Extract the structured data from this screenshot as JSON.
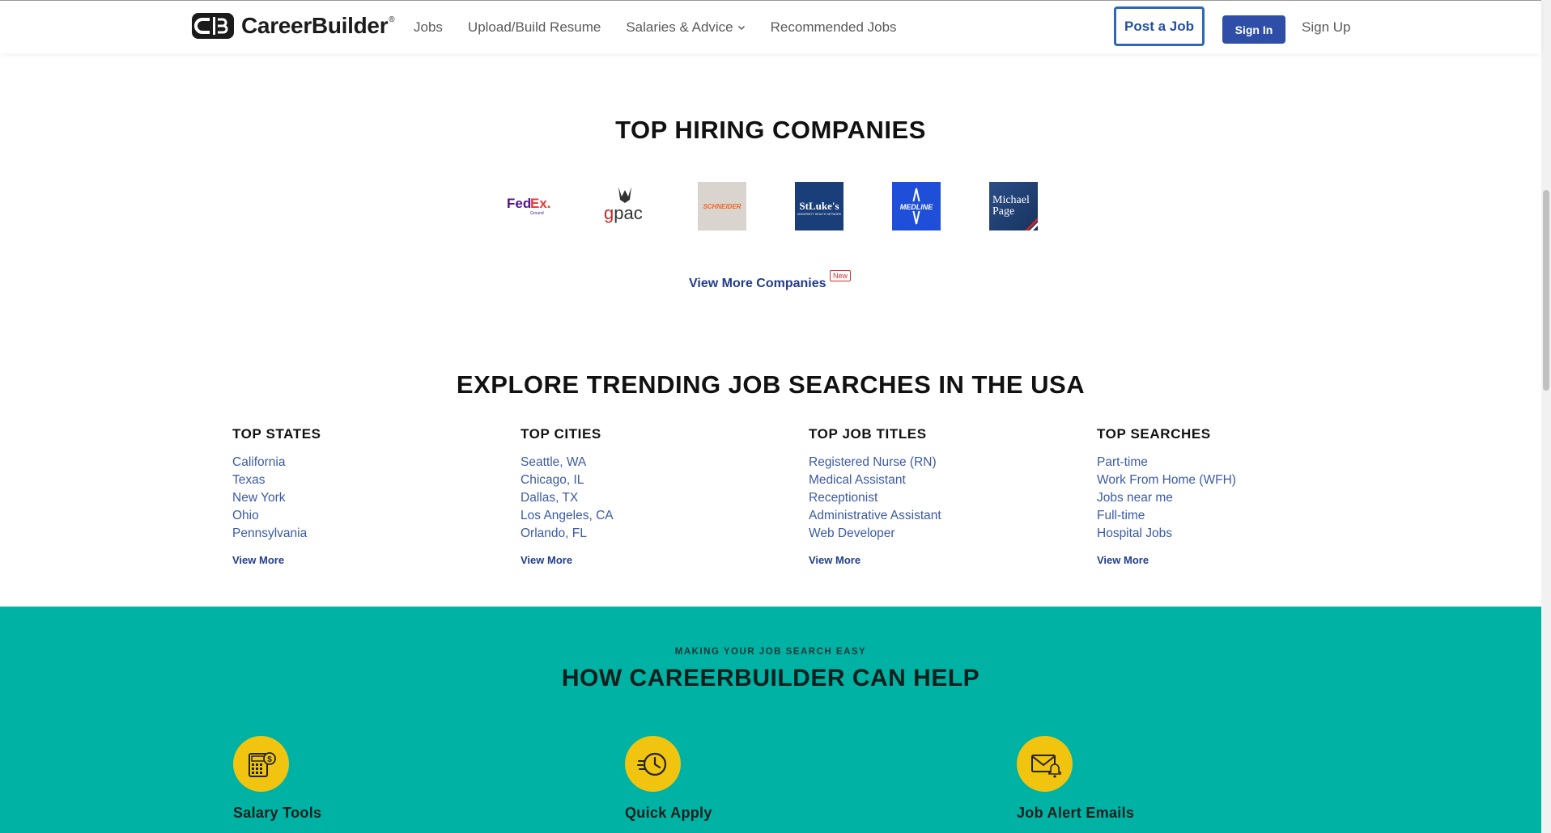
{
  "header": {
    "brand": "CareerBuilder",
    "brand_mark": "®",
    "nav": [
      "Jobs",
      "Upload/Build Resume",
      "Salaries & Advice",
      "Recommended Jobs"
    ],
    "post_job": "Post a Job",
    "sign_in": "Sign In",
    "sign_up": "Sign Up"
  },
  "companies": {
    "title": "TOP HIRING COMPANIES",
    "logos": [
      {
        "name": "fedex-logo",
        "text": "FedEx.",
        "sub": "Ground"
      },
      {
        "name": "gpac-logo",
        "text": "gpac"
      },
      {
        "name": "schneider-logo",
        "text": "SCHNEIDER"
      },
      {
        "name": "st-lukes-logo",
        "text": "StLuke's"
      },
      {
        "name": "medline-logo",
        "text": "MEDLINE"
      },
      {
        "name": "michael-page-logo",
        "text": "Michael Page"
      }
    ],
    "view_more": "View More Companies",
    "new_badge": "New"
  },
  "trending": {
    "title": "EXPLORE TRENDING JOB SEARCHES IN THE USA",
    "columns": [
      {
        "heading": "TOP STATES",
        "links": [
          "California",
          "Texas",
          "New York",
          "Ohio",
          "Pennsylvania"
        ],
        "more": "View More"
      },
      {
        "heading": "TOP CITIES",
        "links": [
          "Seattle, WA",
          "Chicago, IL",
          "Dallas, TX",
          "Los Angeles, CA",
          "Orlando, FL"
        ],
        "more": "View More"
      },
      {
        "heading": "TOP JOB TITLES",
        "links": [
          "Registered Nurse (RN)",
          "Medical Assistant",
          "Receptionist",
          "Administrative Assistant",
          "Web Developer"
        ],
        "more": "View More"
      },
      {
        "heading": "TOP SEARCHES",
        "links": [
          "Part-time",
          "Work From Home (WFH)",
          "Jobs near me",
          "Full-time",
          "Hospital Jobs"
        ],
        "more": "View More"
      }
    ]
  },
  "help": {
    "kicker": "MAKING YOUR JOB SEARCH EASY",
    "title": "HOW CAREERBUILDER CAN HELP",
    "features": [
      {
        "label": "Salary Tools",
        "icon": "calculator-icon"
      },
      {
        "label": "Quick Apply",
        "icon": "clock-icon"
      },
      {
        "label": "Job Alert Emails",
        "icon": "mail-alert-icon"
      }
    ]
  },
  "colors": {
    "link": "#3b5ba4",
    "primary": "#2e4ea8",
    "teal": "#00b2a4",
    "yellow": "#f1c40f"
  }
}
